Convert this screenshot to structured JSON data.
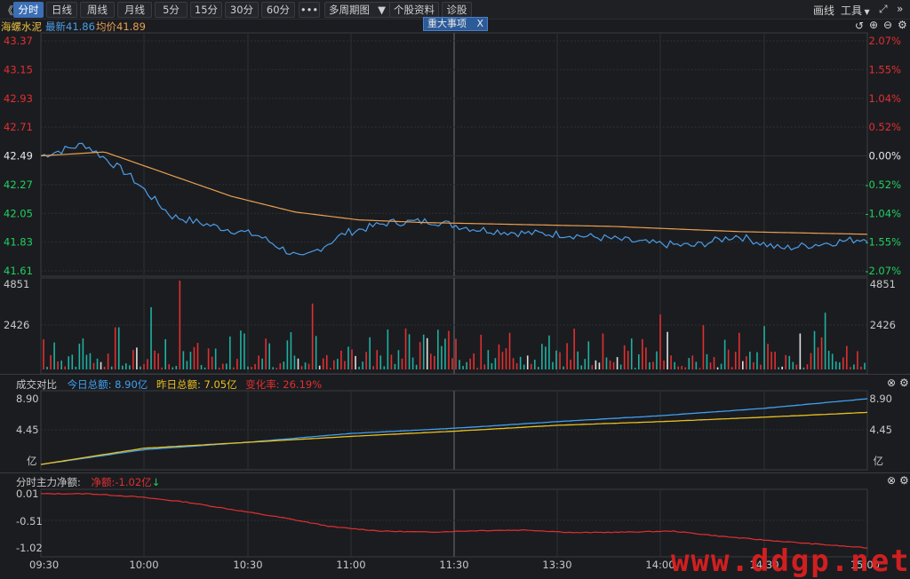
{
  "toolbar": {
    "back_glyph": "《",
    "periods": [
      "分时",
      "日线",
      "周线",
      "月线",
      "5分",
      "15分",
      "30分",
      "60分"
    ],
    "more": "•••",
    "multi_period": "多周期图",
    "stock_info": "个股资料",
    "diagnose": "诊股",
    "draw_line": "画线",
    "tools": "工具"
  },
  "stock": {
    "name": "海螺水泥",
    "latest": "最新41.86",
    "avg": "均价41.89",
    "news_label": "重大事项",
    "news_close": "X"
  },
  "price_axis": {
    "left": [
      "43.37",
      "43.15",
      "42.93",
      "42.71",
      "42.49",
      "42.27",
      "42.05",
      "41.83",
      "41.61"
    ],
    "right": [
      "2.07%",
      "1.55%",
      "1.04%",
      "0.52%",
      "0.00%",
      "-0.52%",
      "-1.04%",
      "-1.55%",
      "-2.07%"
    ]
  },
  "volume_axis": {
    "top": "4851",
    "mid": "2426"
  },
  "turnover": {
    "title": "成交对比",
    "today": "今日总额: 8.90亿",
    "yesterday": "昨日总额: 7.05亿",
    "change": "变化率: 26.19%",
    "axis": [
      "8.90",
      "4.45",
      "亿"
    ]
  },
  "mainforce": {
    "title": "分时主力净额:",
    "net": "净额:-1.02亿",
    "arrow": "↓",
    "axis": [
      "0.01",
      "-0.51",
      "-1.02"
    ]
  },
  "time_axis": [
    "09:30",
    "10:00",
    "10:30",
    "11:00",
    "11:30",
    "13:30",
    "14:00",
    "14:30",
    "15:00"
  ],
  "watermark": "www.ddgp.net",
  "colors": {
    "price_line": "#4a9ee8",
    "avg_line": "#e8a050",
    "up": "#e03030",
    "down": "#1fb0a0",
    "flat": "#e0e0e0",
    "today_line": "#40a0f0",
    "yesterday_line": "#e8c020",
    "mainforce_line": "#e03030"
  },
  "chart_data": {
    "type": "line",
    "title": "海螺水泥",
    "x": [
      "09:30",
      "10:00",
      "10:30",
      "11:00",
      "11:30",
      "13:30",
      "14:00",
      "14:30",
      "15:00"
    ],
    "series": [
      {
        "name": "最新",
        "values": [
          42.49,
          42.03,
          41.82,
          41.97,
          41.9,
          41.85,
          41.79,
          41.8,
          41.86
        ]
      },
      {
        "name": "均价",
        "values": [
          42.49,
          42.18,
          42.03,
          41.99,
          41.97,
          41.94,
          41.92,
          41.9,
          41.89
        ]
      }
    ],
    "ylim": [
      41.61,
      43.37
    ],
    "volume_range": [
      0,
      4851
    ],
    "turnover_series": [
      {
        "name": "今日总额",
        "values": [
          0.0,
          2.0,
          3.0,
          4.2,
          4.9,
          5.8,
          6.6,
          7.6,
          8.9
        ]
      },
      {
        "name": "昨日总额",
        "values": [
          0.0,
          2.2,
          3.0,
          3.8,
          4.5,
          5.3,
          5.8,
          6.4,
          7.05
        ]
      }
    ],
    "turnover_ylim": [
      0,
      8.9
    ],
    "mainforce_series": {
      "name": "净额",
      "values": [
        0.01,
        -0.05,
        -0.4,
        -0.7,
        -0.68,
        -0.73,
        -0.7,
        -0.85,
        -1.02
      ]
    },
    "mainforce_ylim": [
      -1.02,
      0.01
    ]
  }
}
